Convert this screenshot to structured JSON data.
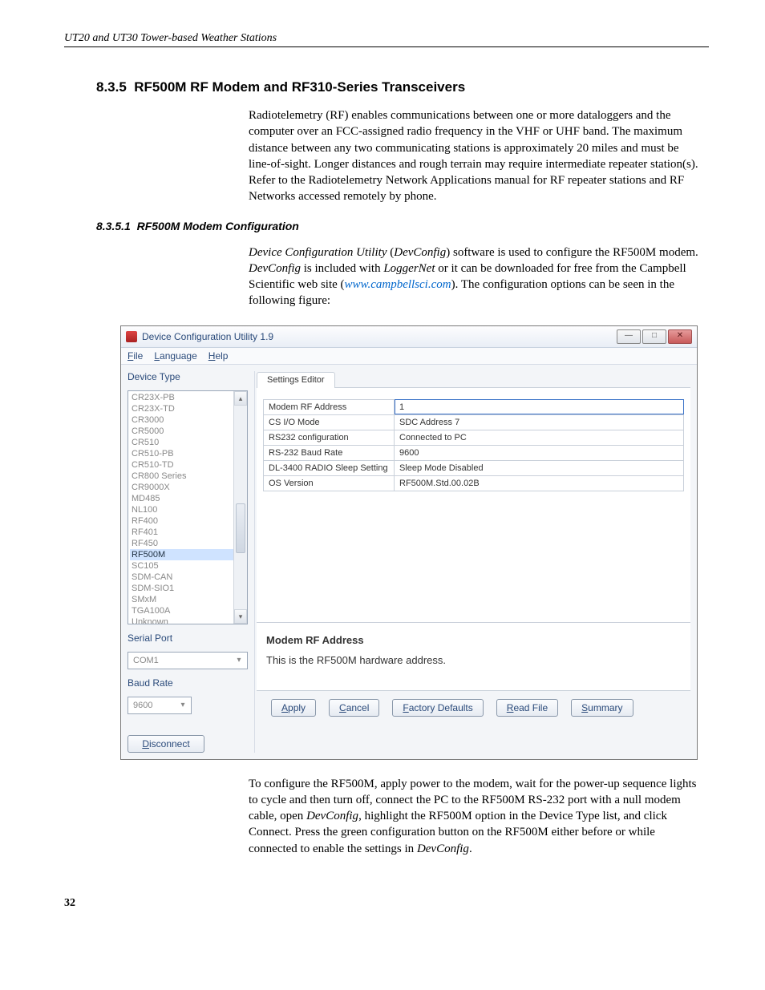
{
  "page": {
    "header": "UT20 and UT30 Tower-based Weather Stations",
    "number": "32"
  },
  "section": {
    "num": "8.3.5",
    "title": "RF500M RF Modem and RF310-Series Transceivers",
    "para1": "Radiotelemetry (RF) enables communications between one or more dataloggers and the computer over an FCC-assigned radio frequency in the VHF or UHF band.  The maximum distance between any two communicating stations is approximately 20 miles and must be line-of-sight.  Longer distances and rough terrain may require intermediate repeater station(s).  Refer to the Radiotelemetry Network Applications manual for RF repeater stations and RF Networks accessed remotely by phone."
  },
  "subsection": {
    "num": "8.3.5.1",
    "title": "RF500M Modem Configuration",
    "p1a": "Device Configuration Utility",
    "p1b": " (",
    "p1c": "DevConfig",
    "p1d": ") software is used to configure the RF500M modem.  ",
    "p1e": "DevConfig",
    "p1f": " is included with ",
    "p1g": "LoggerNet",
    "p1h": " or it can be downloaded for free from the Campbell Scientific web site (",
    "p1link": "www.campbellsci.com",
    "p1i": ").  The configuration options can be seen in the following figure:",
    "p2a": "To configure the RF500M, apply power to the modem, wait for the power-up sequence lights to cycle and then turn off, connect the PC to the RF500M RS-232 port with a null modem cable, open ",
    "p2b": "DevConfig",
    "p2c": ", highlight the RF500M option in the Device Type list, and click Connect.  Press the green configuration button on the RF500M either before or while connected to enable the settings in ",
    "p2d": "DevConfig",
    "p2e": "."
  },
  "dialog": {
    "title": "Device Configuration Utility 1.9",
    "menu": {
      "file": "File",
      "language": "Language",
      "help": "Help"
    },
    "left": {
      "device_type_label": "Device Type",
      "devices": [
        "CR23X-PB",
        "CR23X-TD",
        "CR3000",
        "CR5000",
        "CR510",
        "CR510-PB",
        "CR510-TD",
        "CR800 Series",
        "CR9000X",
        "MD485",
        "NL100",
        "RF400",
        "RF401",
        "RF450",
        "RF500M",
        "SC105",
        "SDM-CAN",
        "SDM-SIO1",
        "SMxM",
        "TGA100A",
        "Unknown"
      ],
      "selected_index": 14,
      "serial_port_label": "Serial Port",
      "serial_port_value": "COM1",
      "baud_rate_label": "Baud Rate",
      "baud_rate_value": "9600",
      "disconnect": "Disconnect"
    },
    "tab": "Settings Editor",
    "settings": [
      {
        "label": "Modem RF Address",
        "value": "1",
        "editing": true
      },
      {
        "label": "CS I/O Mode",
        "value": "SDC Address 7"
      },
      {
        "label": "RS232 configuration",
        "value": "Connected to PC"
      },
      {
        "label": "RS-232 Baud Rate",
        "value": "9600"
      },
      {
        "label": "DL-3400 RADIO Sleep Setting",
        "value": "Sleep Mode Disabled"
      },
      {
        "label": "OS Version",
        "value": "RF500M.Std.00.02B"
      }
    ],
    "help": {
      "title": "Modem RF Address",
      "text": "This is the RF500M hardware address."
    },
    "buttons": {
      "apply": "Apply",
      "cancel": "Cancel",
      "factory": "Factory Defaults",
      "read": "Read File",
      "summary": "Summary"
    }
  }
}
